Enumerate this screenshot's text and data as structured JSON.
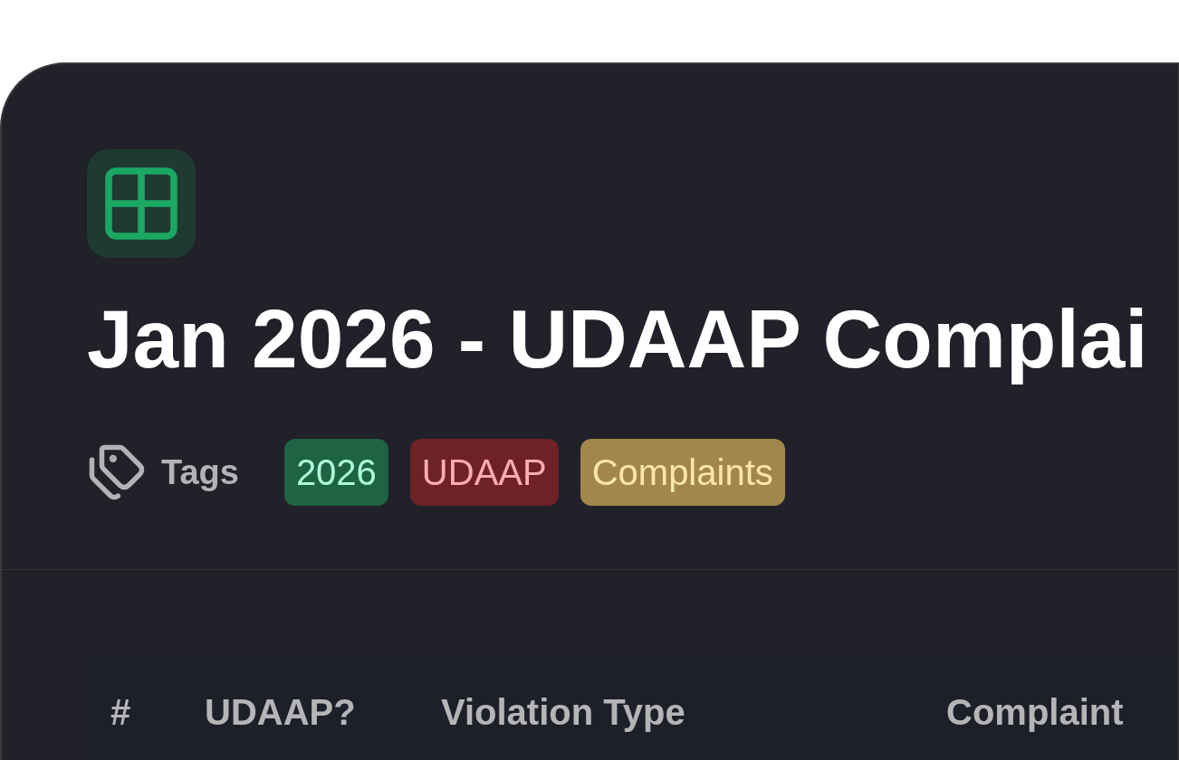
{
  "header": {
    "title": "Jan 2026 - UDAAP Complai",
    "tags_label": "Tags",
    "tags": [
      {
        "label": "2026",
        "color": "#1e6343"
      },
      {
        "label": "UDAAP",
        "color": "#6e2226"
      },
      {
        "label": "Complaints",
        "color": "#a3874a"
      }
    ]
  },
  "table": {
    "columns": [
      "#",
      "UDAAP?",
      "Violation Type",
      "Complaint"
    ]
  }
}
